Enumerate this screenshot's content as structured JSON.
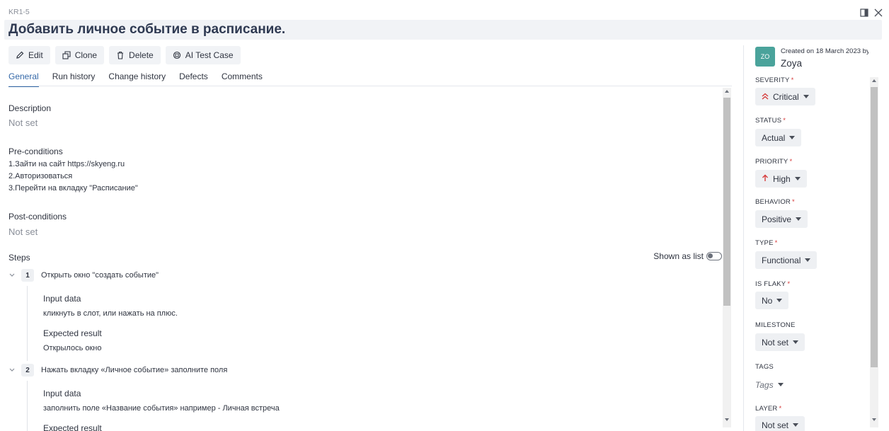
{
  "header": {
    "case_id": "KR1-5",
    "title": "Добавить личное событие в расписание."
  },
  "toolbar": {
    "edit": "Edit",
    "clone": "Clone",
    "delete": "Delete",
    "ai_test_case": "AI Test Case"
  },
  "tabs": [
    "General",
    "Run history",
    "Change history",
    "Defects",
    "Comments"
  ],
  "main": {
    "description_label": "Description",
    "description_value": "Not set",
    "preconditions_label": "Pre-conditions",
    "preconditions_lines": [
      "1.Зайти на сайт https://skyeng.ru",
      "2.Авторизоваться",
      "3.Перейти на вкладку \"Расписание\""
    ],
    "postconditions_label": "Post-conditions",
    "postconditions_value": "Not set",
    "steps_label": "Steps",
    "shown_as_list": "Shown as list",
    "input_data_label": "Input data",
    "expected_result_label": "Expected result",
    "steps": [
      {
        "num": "1",
        "action": "Открыть окно \"создать событие\"",
        "input": "кликнуть в слот, или нажать на плюс.",
        "expected": "Открылось окно"
      },
      {
        "num": "2",
        "action": "Нажать вкладку «Личное событие» заполните поля",
        "input": "заполнить поле «Название события» например - Личная встреча",
        "expected": ""
      }
    ]
  },
  "sidebar": {
    "avatar_initials": "ZO",
    "created": "Created on 18 March 2023 by",
    "author": "Zoya",
    "fields": {
      "severity": {
        "label": "SEVERITY",
        "value": "Critical"
      },
      "status": {
        "label": "STATUS",
        "value": "Actual"
      },
      "priority": {
        "label": "PRIORITY",
        "value": "High"
      },
      "behavior": {
        "label": "BEHAVIOR",
        "value": "Positive"
      },
      "type": {
        "label": "TYPE",
        "value": "Functional"
      },
      "is_flaky": {
        "label": "IS FLAKY",
        "value": "No"
      },
      "milestone": {
        "label": "MILESTONE",
        "value": "Not set"
      },
      "tags": {
        "label": "TAGS",
        "value": "Tags"
      },
      "layer": {
        "label": "LAYER",
        "value": "Not set"
      }
    }
  },
  "colors": {
    "accent": "#3468a8",
    "required": "#d63b3b",
    "avatar": "#4aa39b",
    "critical_icon": "#d63b3b",
    "high_icon": "#d63b3b"
  },
  "icons": {
    "edit": "pencil-icon",
    "clone": "clone-icon",
    "delete": "trash-icon",
    "ai": "ai-chip-icon",
    "severity": "double-chevron-up-icon",
    "priority": "arrow-up-icon"
  }
}
